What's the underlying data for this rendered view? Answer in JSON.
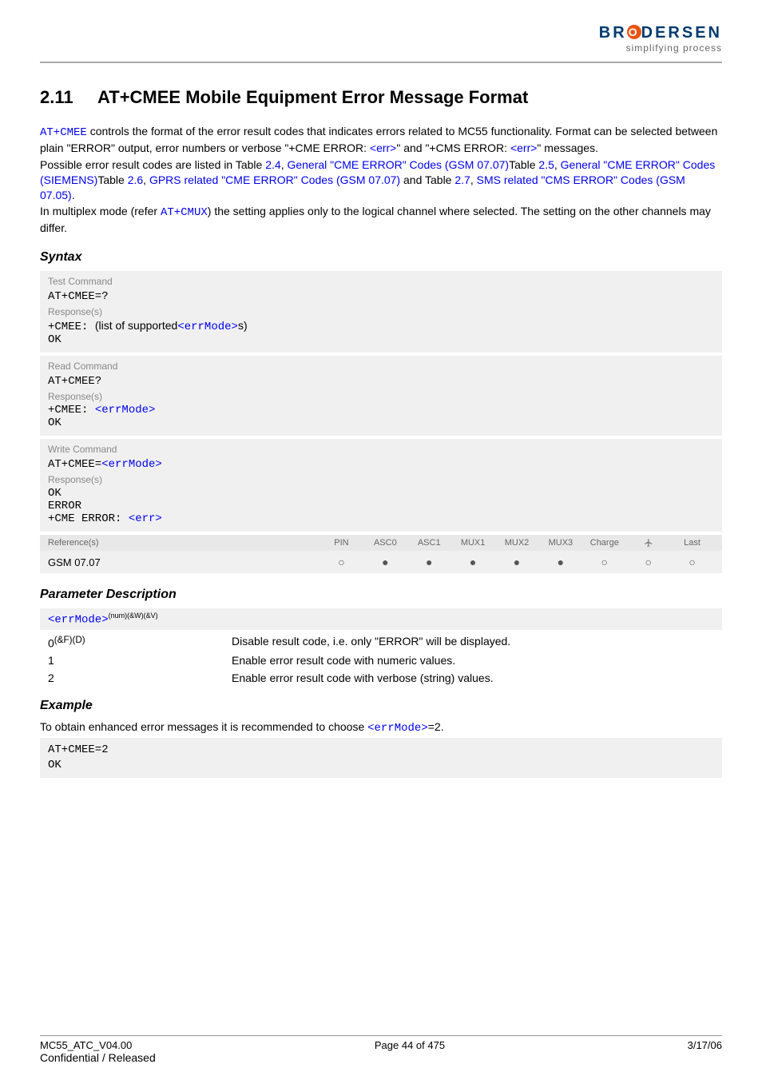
{
  "logo": {
    "brand": "BRODERSEN",
    "tagline": "simplifying process"
  },
  "section": {
    "number": "2.11",
    "title": "AT+CMEE   Mobile Equipment Error Message Format"
  },
  "intro": {
    "cmd": "AT+CMEE",
    "line1_a": " controls the format of the error result codes that indicates errors related to MC55 functionality. Format can be selected between plain \"ERROR\" output, error numbers or verbose \"+CME ERROR: ",
    "err1": "<err>",
    "line1_b": "\" and \"+CMS ERROR: ",
    "err2": "<err>",
    "line1_c": "\" messages.",
    "line2_a": "Possible error result codes are listed in Table ",
    "t24": "2.4",
    "t24_name": "General \"CME ERROR\" Codes (GSM 07.07)",
    "line2_b": "Table ",
    "t25": "2.5",
    "t25_name": "General \"CME ERROR\" Codes (SIEMENS)",
    "line2_c": "Table ",
    "t26": "2.6",
    "t26_name": "GPRS related \"CME ERROR\" Codes (GSM 07.07)",
    "line2_d": " and Table ",
    "t27": "2.7",
    "t27_name": "SMS related \"CMS ERROR\" Codes (GSM 07.05)",
    "line2_e": ".",
    "line3_a": "In multiplex mode (refer ",
    "cmux": "AT+CMUX",
    "line3_b": ") the setting applies only to the logical channel where selected. The setting on the other channels may differ."
  },
  "syntax": {
    "heading": "Syntax",
    "test": {
      "label": "Test Command",
      "cmd": "AT+CMEE=?",
      "resp_label": "Response(s)",
      "resp_prefix": "+CMEE: ",
      "resp_mid": "(list of supported",
      "resp_errmode": "<errMode>",
      "resp_suffix": "s)",
      "ok": "OK"
    },
    "read": {
      "label": "Read Command",
      "cmd": "AT+CMEE?",
      "resp_label": "Response(s)",
      "resp_prefix": "+CMEE: ",
      "resp_errmode": "<errMode>",
      "ok": "OK"
    },
    "write": {
      "label": "Write Command",
      "cmd_prefix": "AT+CMEE=",
      "cmd_errmode": "<errMode>",
      "resp_label": "Response(s)",
      "ok": "OK",
      "error": "ERROR",
      "cme_prefix": "+CME ERROR: ",
      "cme_err": "<err>"
    },
    "ref": {
      "label": "Reference(s)",
      "cols": [
        "PIN",
        "ASC0",
        "ASC1",
        "MUX1",
        "MUX2",
        "MUX3",
        "Charge",
        "",
        "Last"
      ],
      "value": "GSM 07.07",
      "dots": [
        "○",
        "●",
        "●",
        "●",
        "●",
        "●",
        "○",
        "○",
        "○"
      ]
    }
  },
  "params": {
    "heading": "Parameter Description",
    "tag_name": "<errMode>",
    "tag_sup": "(num)(&W)(&V)",
    "rows": [
      {
        "k": "0",
        "ksup": "(&F)(D)",
        "v": "Disable result code, i.e. only \"ERROR\" will be displayed."
      },
      {
        "k": "1",
        "ksup": "",
        "v": "Enable error result code with numeric values."
      },
      {
        "k": "2",
        "ksup": "",
        "v": "Enable error result code with verbose (string) values."
      }
    ]
  },
  "example": {
    "heading": "Example",
    "text_a": "To obtain enhanced error messages it is recommended to choose ",
    "errmode": "<errMode>",
    "text_b": "=2.",
    "code1": "AT+CMEE=2",
    "code2": "OK"
  },
  "footer": {
    "left1": "MC55_ATC_V04.00",
    "left2": "Confidential / Released",
    "center": "Page 44 of 475",
    "right": "3/17/06"
  }
}
